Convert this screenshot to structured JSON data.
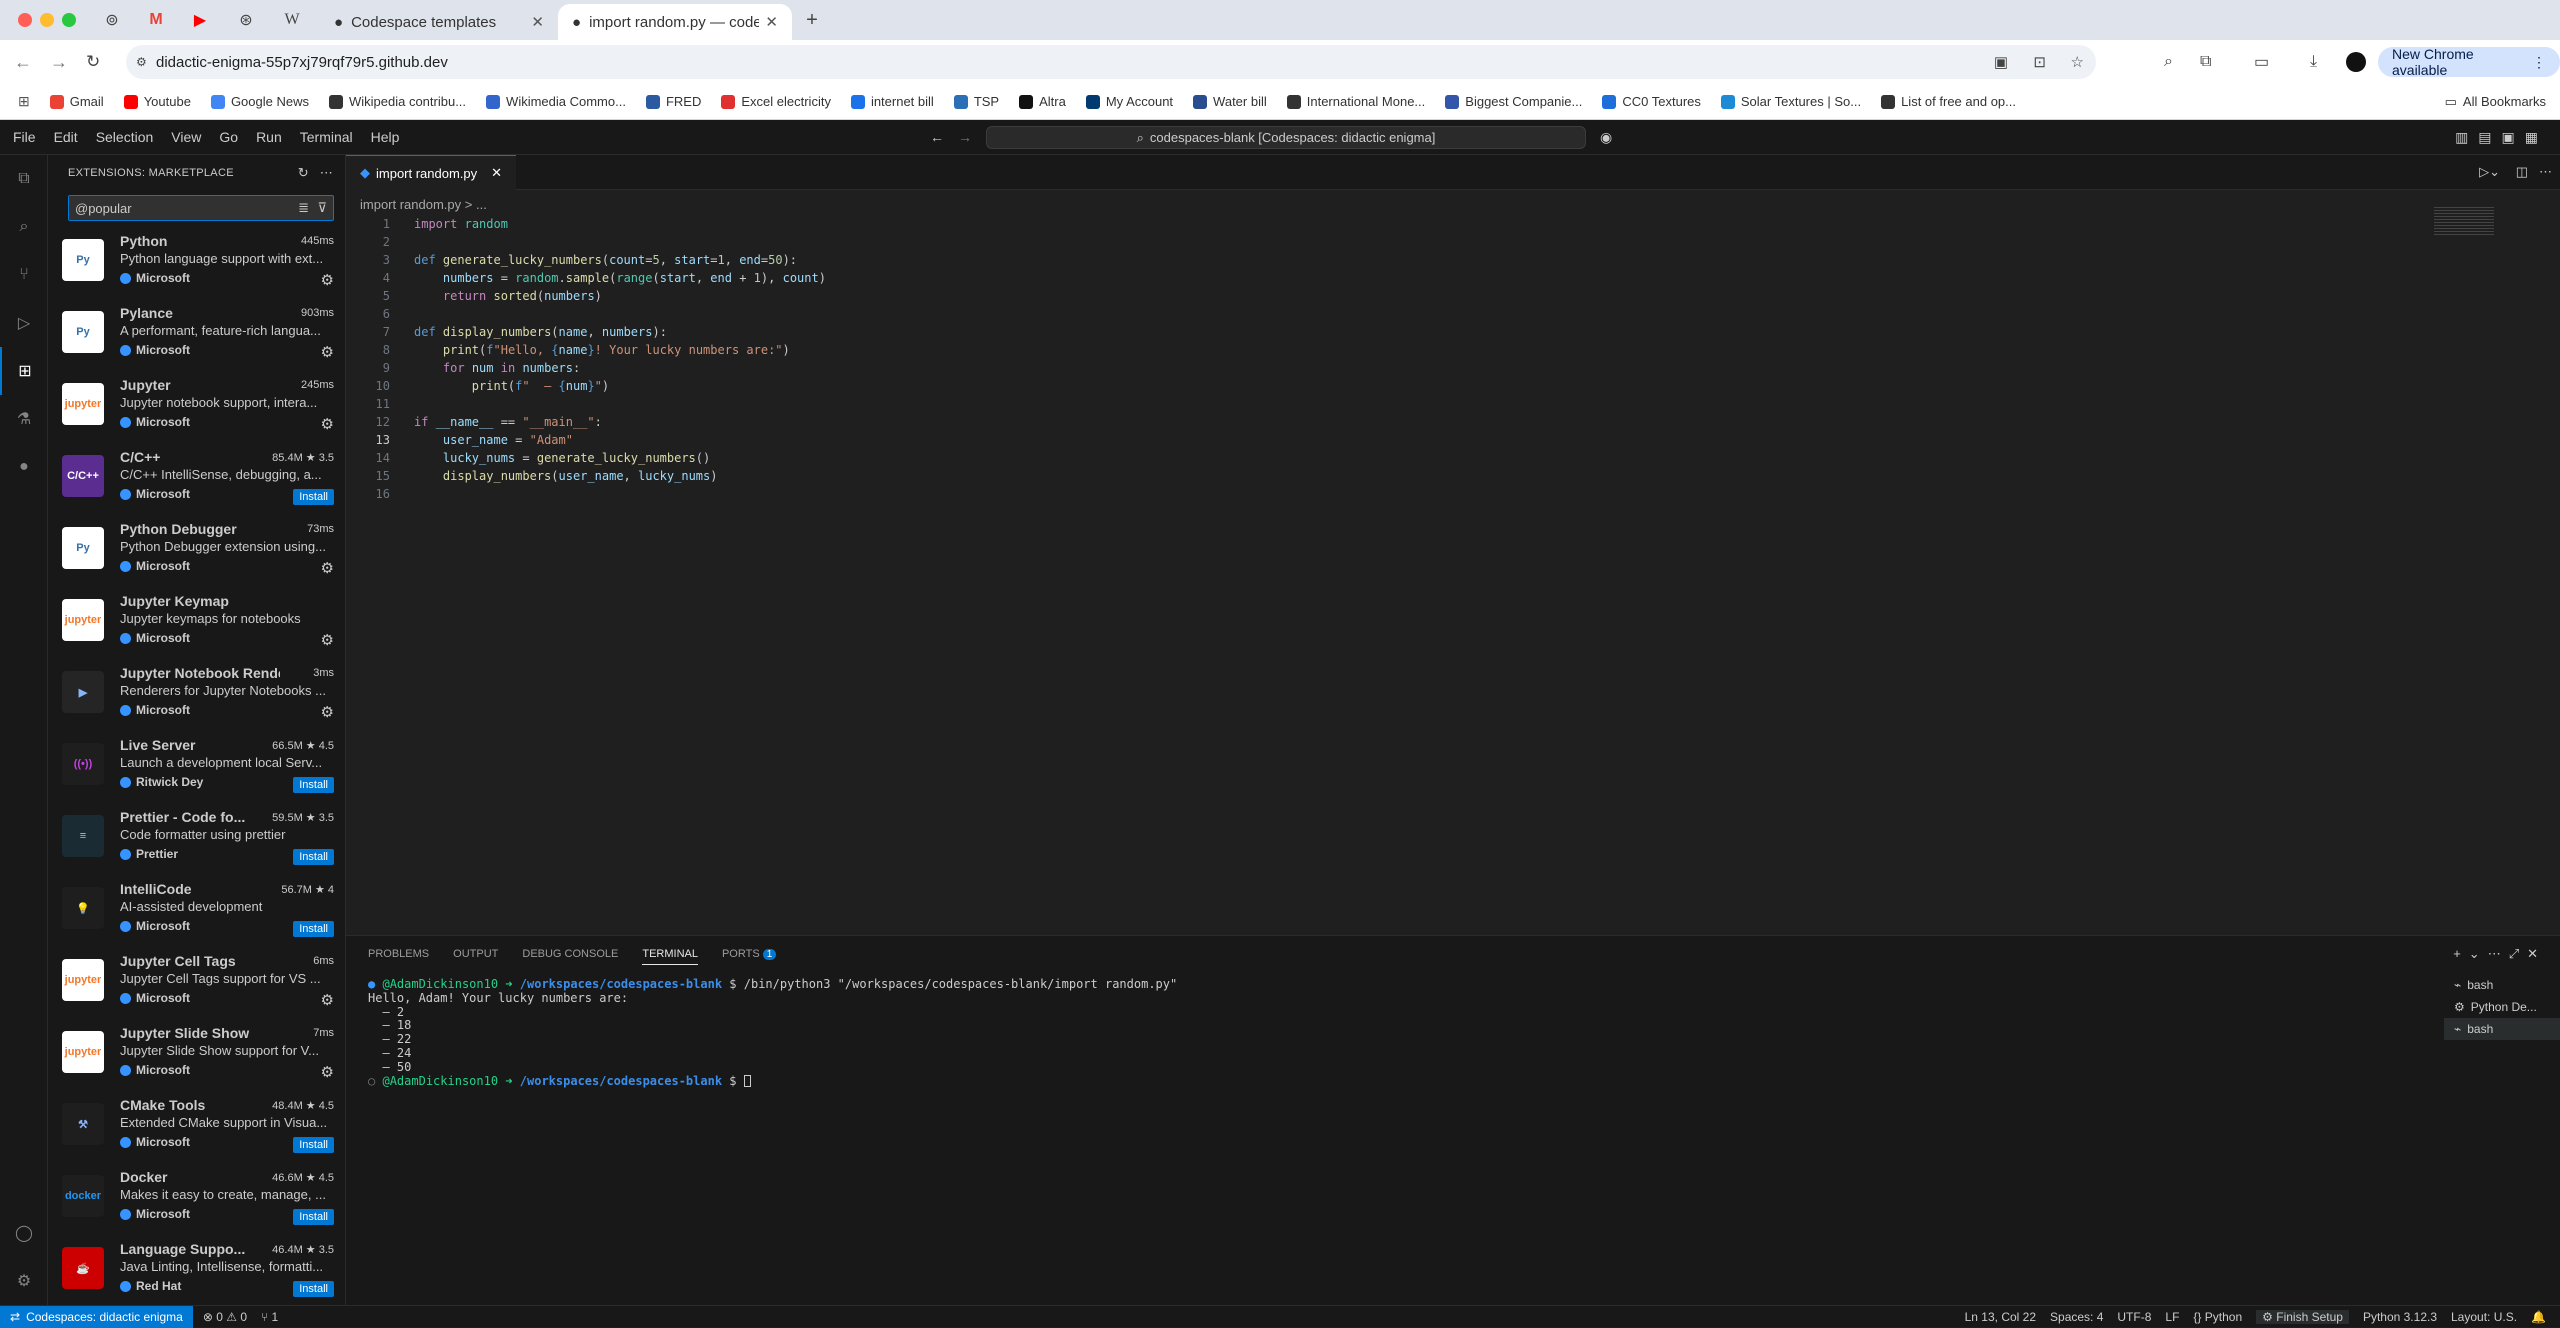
{
  "browser": {
    "tabs": [
      {
        "title": "Codespace templates"
      },
      {
        "title": "import random.py — codespa"
      }
    ],
    "url": "didactic-enigma-55p7xj79rqf79r5.github.dev",
    "update_label": "New Chrome available",
    "all_bookmarks": "All Bookmarks",
    "bookmarks": [
      {
        "label": "Gmail",
        "color": "#ea4335"
      },
      {
        "label": "Youtube",
        "color": "#ff0000"
      },
      {
        "label": "Google News",
        "color": "#4285f4"
      },
      {
        "label": "Wikipedia contribu...",
        "color": "#333333"
      },
      {
        "label": "Wikimedia Commo...",
        "color": "#3366cc"
      },
      {
        "label": "FRED",
        "color": "#2c5aa0"
      },
      {
        "label": "Excel electricity",
        "color": "#e03030"
      },
      {
        "label": "internet bill",
        "color": "#1a73e8"
      },
      {
        "label": "TSP",
        "color": "#2c6fb7"
      },
      {
        "label": "Altra",
        "color": "#111111"
      },
      {
        "label": "My Account",
        "color": "#003a70"
      },
      {
        "label": "Water bill",
        "color": "#2a4d8f"
      },
      {
        "label": "International Mone...",
        "color": "#333333"
      },
      {
        "label": "Biggest Companie...",
        "color": "#3355aa"
      },
      {
        "label": "CC0 Textures",
        "color": "#1e6fd9"
      },
      {
        "label": "Solar Textures | So...",
        "color": "#1d8ad6"
      },
      {
        "label": "List of free and op...",
        "color": "#333333"
      }
    ]
  },
  "vscode": {
    "menu": [
      "File",
      "Edit",
      "Selection",
      "View",
      "Go",
      "Run",
      "Terminal",
      "Help"
    ],
    "command_center": "codespaces-blank [Codespaces: didactic enigma]",
    "sidebar_title": "EXTENSIONS: MARKETPLACE",
    "search_value": "@popular",
    "extensions": [
      {
        "name": "Python",
        "meta": "445ms",
        "desc": "Python language support with ext...",
        "publisher": "Microsoft",
        "action": "gear",
        "logo": "Py",
        "logo_bg": "#ffffff",
        "logo_fg": "#3572a5"
      },
      {
        "name": "Pylance",
        "meta": "903ms",
        "desc": "A performant, feature-rich langua...",
        "publisher": "Microsoft",
        "action": "gear",
        "logo": "Py",
        "logo_bg": "#ffffff",
        "logo_fg": "#3572a5"
      },
      {
        "name": "Jupyter",
        "meta": "245ms",
        "desc": "Jupyter notebook support, intera...",
        "publisher": "Microsoft",
        "action": "gear",
        "logo": "jupyter",
        "logo_bg": "#ffffff",
        "logo_fg": "#f37726"
      },
      {
        "name": "C/C++",
        "meta": "85.4M ★ 3.5",
        "desc": "C/C++ IntelliSense, debugging, a...",
        "publisher": "Microsoft",
        "action": "Install",
        "logo": "C/C++",
        "logo_bg": "#5c2d91",
        "logo_fg": "#ffffff"
      },
      {
        "name": "Python Debugger",
        "meta": "73ms",
        "desc": "Python Debugger extension using...",
        "publisher": "Microsoft",
        "action": "gear",
        "logo": "Py",
        "logo_bg": "#ffffff",
        "logo_fg": "#3572a5"
      },
      {
        "name": "Jupyter Keymap",
        "meta": "",
        "desc": "Jupyter keymaps for notebooks",
        "publisher": "Microsoft",
        "action": "gear",
        "logo": "jupyter",
        "logo_bg": "#ffffff",
        "logo_fg": "#f37726"
      },
      {
        "name": "Jupyter Notebook Rende...",
        "meta": "3ms",
        "desc": "Renderers for Jupyter Notebooks ...",
        "publisher": "Microsoft",
        "action": "gear",
        "logo": "▶",
        "logo_bg": "#252526",
        "logo_fg": "#8ab4f8"
      },
      {
        "name": "Live Server",
        "meta": "66.5M ★ 4.5",
        "desc": "Launch a development local Serv...",
        "publisher": "Ritwick Dey",
        "action": "Install",
        "logo": "((•))",
        "logo_bg": "#1e1e1e",
        "logo_fg": "#c040e0"
      },
      {
        "name": "Prettier - Code fo...",
        "meta": "59.5M ★ 3.5",
        "desc": "Code formatter using prettier",
        "publisher": "Prettier",
        "action": "Install",
        "logo": "≡",
        "logo_bg": "#1a2b34",
        "logo_fg": "#f7b93e"
      },
      {
        "name": "IntelliCode",
        "meta": "56.7M ★ 4",
        "desc": "AI-assisted development",
        "publisher": "Microsoft",
        "action": "Install",
        "logo": "💡",
        "logo_bg": "#1e1e1e",
        "logo_fg": "#b180d7"
      },
      {
        "name": "Jupyter Cell Tags",
        "meta": "6ms",
        "desc": "Jupyter Cell Tags support for VS ...",
        "publisher": "Microsoft",
        "action": "gear",
        "logo": "jupyter",
        "logo_bg": "#ffffff",
        "logo_fg": "#f37726"
      },
      {
        "name": "Jupyter Slide Show",
        "meta": "7ms",
        "desc": "Jupyter Slide Show support for V...",
        "publisher": "Microsoft",
        "action": "gear",
        "logo": "jupyter",
        "logo_bg": "#ffffff",
        "logo_fg": "#f37726"
      },
      {
        "name": "CMake Tools",
        "meta": "48.4M ★ 4.5",
        "desc": "Extended CMake support in Visua...",
        "publisher": "Microsoft",
        "action": "Install",
        "logo": "⚒",
        "logo_bg": "#1e1e1e",
        "logo_fg": "#8ab4f8"
      },
      {
        "name": "Docker",
        "meta": "46.6M ★ 4.5",
        "desc": "Makes it easy to create, manage, ...",
        "publisher": "Microsoft",
        "action": "Install",
        "logo": "docker",
        "logo_bg": "#1e1e1e",
        "logo_fg": "#2496ed"
      },
      {
        "name": "Language Suppo...",
        "meta": "46.4M ★ 3.5",
        "desc": "Java Linting, Intellisense, formatti...",
        "publisher": "Red Hat",
        "action": "Install",
        "logo": "☕",
        "logo_bg": "#cc0000",
        "logo_fg": "#ffffff"
      }
    ],
    "editor_tab": "import random.py",
    "breadcrumb": "import random.py > ...",
    "panel_tabs": [
      "PROBLEMS",
      "OUTPUT",
      "DEBUG CONSOLE",
      "TERMINAL",
      "PORTS"
    ],
    "ports_badge": "1",
    "terminal": {
      "user": "@AdamDickinson10",
      "path": "/workspaces/codespaces-blank",
      "command": "$ /bin/python3 \"/workspaces/codespaces-blank/import random.py\"",
      "output": [
        "Hello, Adam! Your lucky numbers are:",
        "  – 2",
        "  – 18",
        "  – 22",
        "  – 24",
        "  – 50"
      ],
      "prompt": "$"
    },
    "terminal_list": [
      "bash",
      "Python De...",
      "bash"
    ],
    "status": {
      "remote": "Codespaces: didactic enigma",
      "problems": "⊗ 0 ⚠ 0",
      "ports": "1",
      "position": "Ln 13, Col 22",
      "spaces": "Spaces: 4",
      "encoding": "UTF-8",
      "eol": "LF",
      "language": "Python",
      "finish": "Finish Setup",
      "interpreter": "Python 3.12.3",
      "layout": "Layout: U.S."
    }
  }
}
